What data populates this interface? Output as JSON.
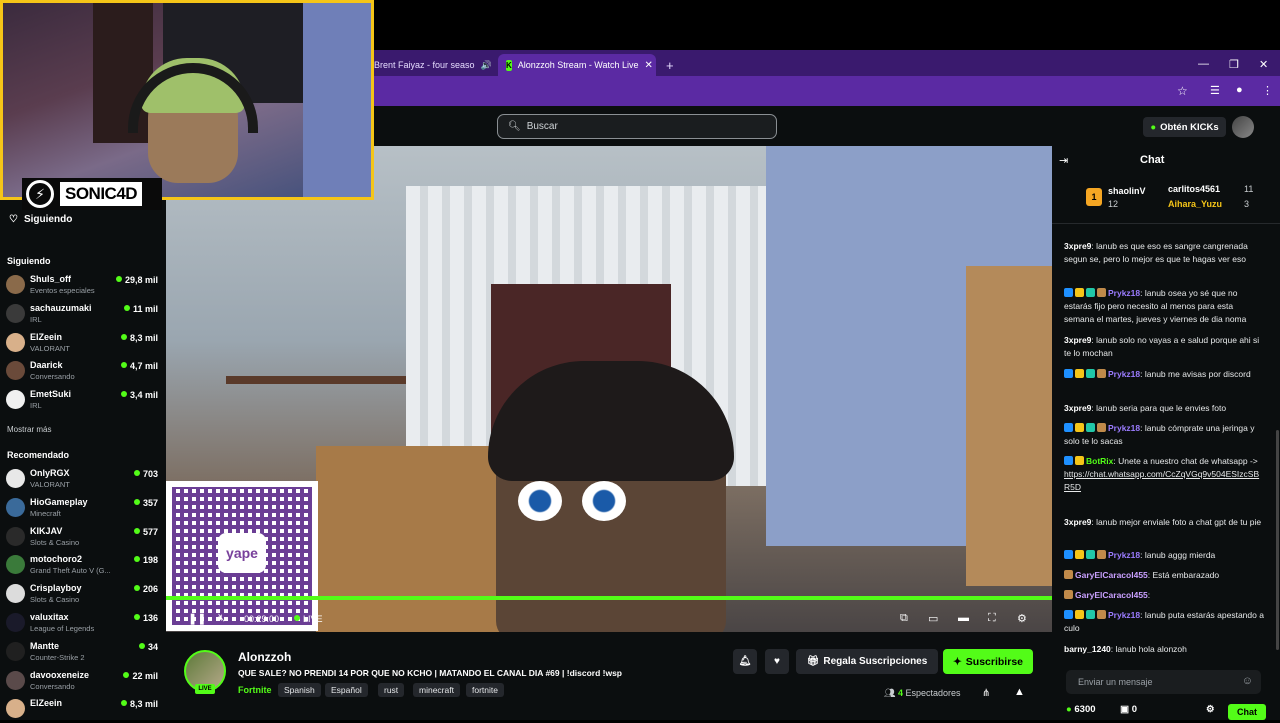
{
  "browser": {
    "tabs": [
      {
        "label": "Brent Faiyaz - four seaso",
        "active": false
      },
      {
        "label": "Alonzzoh Stream - Watch Live",
        "active": true
      }
    ],
    "new_tab": "+"
  },
  "overlay": {
    "logo_text": "SONIC4D"
  },
  "header": {
    "search_placeholder": "Buscar",
    "get_kicks": "Obtén KICKs"
  },
  "sidebar": {
    "following_title": "Siguiendo",
    "following_heading": "Siguiendo",
    "following": [
      {
        "name": "Shuls_off",
        "category": "Eventos especiales",
        "viewers": "29,8 mil",
        "color": "#8a6a4a"
      },
      {
        "name": "sachauzumaki",
        "category": "IRL",
        "viewers": "11 mil",
        "color": "#3a3a3a"
      },
      {
        "name": "ElZeein",
        "category": "VALORANT",
        "viewers": "8,3 mil",
        "color": "#d8b08a"
      },
      {
        "name": "Daarick",
        "category": "Conversando",
        "viewers": "4,7 mil",
        "color": "#6a4a3a"
      },
      {
        "name": "EmetSuki",
        "category": "IRL",
        "viewers": "3,4 mil",
        "color": "#f0f0f0"
      }
    ],
    "show_more": "Mostrar más",
    "recommended_heading": "Recomendado",
    "recommended": [
      {
        "name": "OnlyRGX",
        "category": "VALORANT",
        "viewers": "703",
        "color": "#e8e8e8"
      },
      {
        "name": "HioGameplay",
        "category": "Minecraft",
        "viewers": "357",
        "color": "#3a6a9a"
      },
      {
        "name": "KIKJAV",
        "category": "Slots & Casino",
        "viewers": "577",
        "color": "#2a2a2a"
      },
      {
        "name": "motochoro2",
        "category": "Grand Theft Auto V (G...",
        "viewers": "198",
        "color": "#3a7a3a"
      },
      {
        "name": "Crisplayboy",
        "category": "Slots & Casino",
        "viewers": "206",
        "color": "#dcdcdc"
      },
      {
        "name": "valuxitax",
        "category": "League of Legends",
        "viewers": "136",
        "color": "#1a1a2a"
      },
      {
        "name": "Mantte",
        "category": "Counter-Strike 2",
        "viewers": "34",
        "color": "#202020"
      },
      {
        "name": "davooxeneize",
        "category": "Conversando",
        "viewers": "22 mil",
        "color": "#5a4a4a"
      },
      {
        "name": "ElZeein",
        "category": "",
        "viewers": "8,3 mil",
        "color": "#d8b08a"
      }
    ]
  },
  "player": {
    "time": "00:29:00",
    "live": "LIVE",
    "qr_brand": "yape"
  },
  "stream": {
    "channel": "Alonzzoh",
    "live_badge": "LIVE",
    "title": "QUE SALE? NO PRENDI 14 POR QUE NO KCHO | MATANDO EL CANAL DIA #69 | !discord !wsp",
    "category": "Fortnite",
    "tags": [
      "Spanish",
      "Español",
      "rust",
      "minecraft",
      "fortnite"
    ],
    "gift_label": "Regala Suscripciones",
    "subscribe_label": "Suscribirse",
    "viewers_count": "4",
    "viewers_label": "Espectadores"
  },
  "chat": {
    "title": "Chat",
    "pinned": [
      {
        "name": "shaolinV",
        "count": "12"
      },
      {
        "name": "carlitos4561",
        "count": "11"
      },
      {
        "name": "Aihara_Yuzu",
        "count": "3"
      }
    ],
    "messages": [
      {
        "user": "3xpre9",
        "color": "#ffffff",
        "badges": 0,
        "text": ": lanub es que eso es sangre cangrenada segun se, pero lo mejor es que te hagas ver eso"
      },
      {
        "user": "Prykz18",
        "color": "#9b7cff",
        "badges": 4,
        "text": ": lanub osea yo sé que no estarás fijo pero necesito al menos para esta semana el martes, jueves y viernes de dia noma"
      },
      {
        "user": "3xpre9",
        "color": "#ffffff",
        "badges": 0,
        "text": ": lanub solo no vayas a e salud porque ahi si te lo mochan"
      },
      {
        "user": "Prykz18",
        "color": "#9b7cff",
        "badges": 4,
        "text": ": lanub me avisas por discord"
      },
      {
        "user": "3xpre9",
        "color": "#ffffff",
        "badges": 0,
        "text": ": lanub seria para que le envies foto"
      },
      {
        "user": "Prykz18",
        "color": "#9b7cff",
        "badges": 4,
        "text": ": lanub cómprate una jeringa y solo te lo sacas"
      },
      {
        "user": "BotRix",
        "color": "#53fc18",
        "badges": 2,
        "text": ": Unete a nuestro chat de whatsapp ->",
        "link": "https://chat.whatsapp.com/CcZqVGq9v504ESIzcSBR5D"
      },
      {
        "user": "3xpre9",
        "color": "#ffffff",
        "badges": 0,
        "text": ": lanub mejor enviale foto a chat gpt de tu pie"
      },
      {
        "user": "Prykz18",
        "color": "#9b7cff",
        "badges": 4,
        "text": ": lanub aggg mierda"
      },
      {
        "user": "GaryElCaracol455",
        "color": "#c9a0ff",
        "badges": 1,
        "text": ": Está embarazado"
      },
      {
        "user": "GaryElCaracol455",
        "color": "#c9a0ff",
        "badges": 1,
        "text": ":"
      },
      {
        "user": "Prykz18",
        "color": "#9b7cff",
        "badges": 4,
        "text": ": lanub puta estarás apestando a culo"
      },
      {
        "user": "barny_1240",
        "color": "#ffffff",
        "badges": 0,
        "text": ": lanub hola alonzoh"
      }
    ],
    "input_placeholder": "Enviar un mensaje",
    "kicks_balance": "6300",
    "gift_count": "0",
    "send_label": "Chat"
  }
}
